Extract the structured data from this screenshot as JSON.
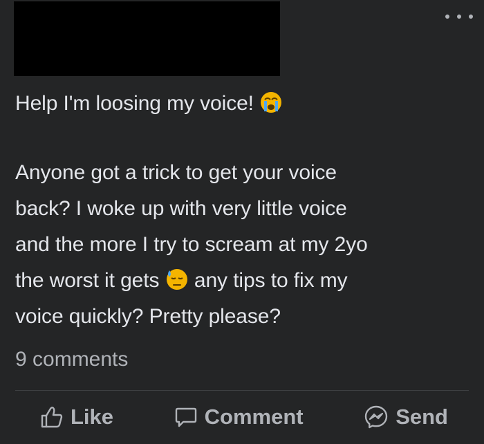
{
  "post": {
    "title_line": "Help I'm loosing my voice!",
    "title_emoji": "loudly-crying-face-emoji",
    "line1": "Anyone got a trick to get your voice",
    "line2": "back? I woke up with very little voice",
    "line3": "and the more I try to scream at my 2yo",
    "line4_before": "the worst it gets",
    "line4_emoji": "downcast-face-with-sweat-emoji",
    "line4_after": "any tips to fix my",
    "line5": "voice quickly? Pretty please?"
  },
  "stats": {
    "comments": "9 comments"
  },
  "actions": {
    "like": {
      "label": "Like",
      "icon": "thumbs-up-icon"
    },
    "comment": {
      "label": "Comment",
      "icon": "speech-bubble-icon"
    },
    "send": {
      "label": "Send",
      "icon": "messenger-icon"
    }
  },
  "header": {
    "menu_icon": "more-options-icon"
  },
  "colors": {
    "background": "#242526",
    "text_primary": "#e4e6eb",
    "text_secondary": "#b0b3b8",
    "divider": "#3e4042",
    "redaction": "#000000"
  }
}
